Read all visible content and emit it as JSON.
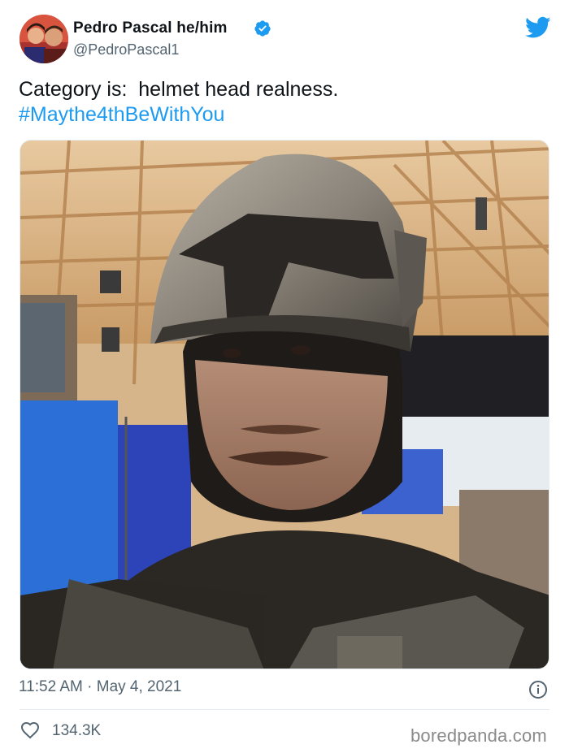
{
  "tweet": {
    "author": {
      "display_name": "Pedro Pascal he/him",
      "handle": "@PedroPascal1",
      "verified": true
    },
    "text_line_1": "Category is:  helmet head realness.",
    "hashtag": "#Maythe4thBeWithYou",
    "timestamp": "11:52 AM · May 4, 2021",
    "likes": "134.3K"
  },
  "icons": {
    "brand": "twitter-bird-icon",
    "verified": "verified-badge-icon",
    "info": "info-icon",
    "like": "heart-icon"
  },
  "watermark": "boredpanda.com",
  "colors": {
    "accent": "#1d9bf0",
    "secondary_text": "#536471",
    "primary_text": "#0f1419"
  }
}
